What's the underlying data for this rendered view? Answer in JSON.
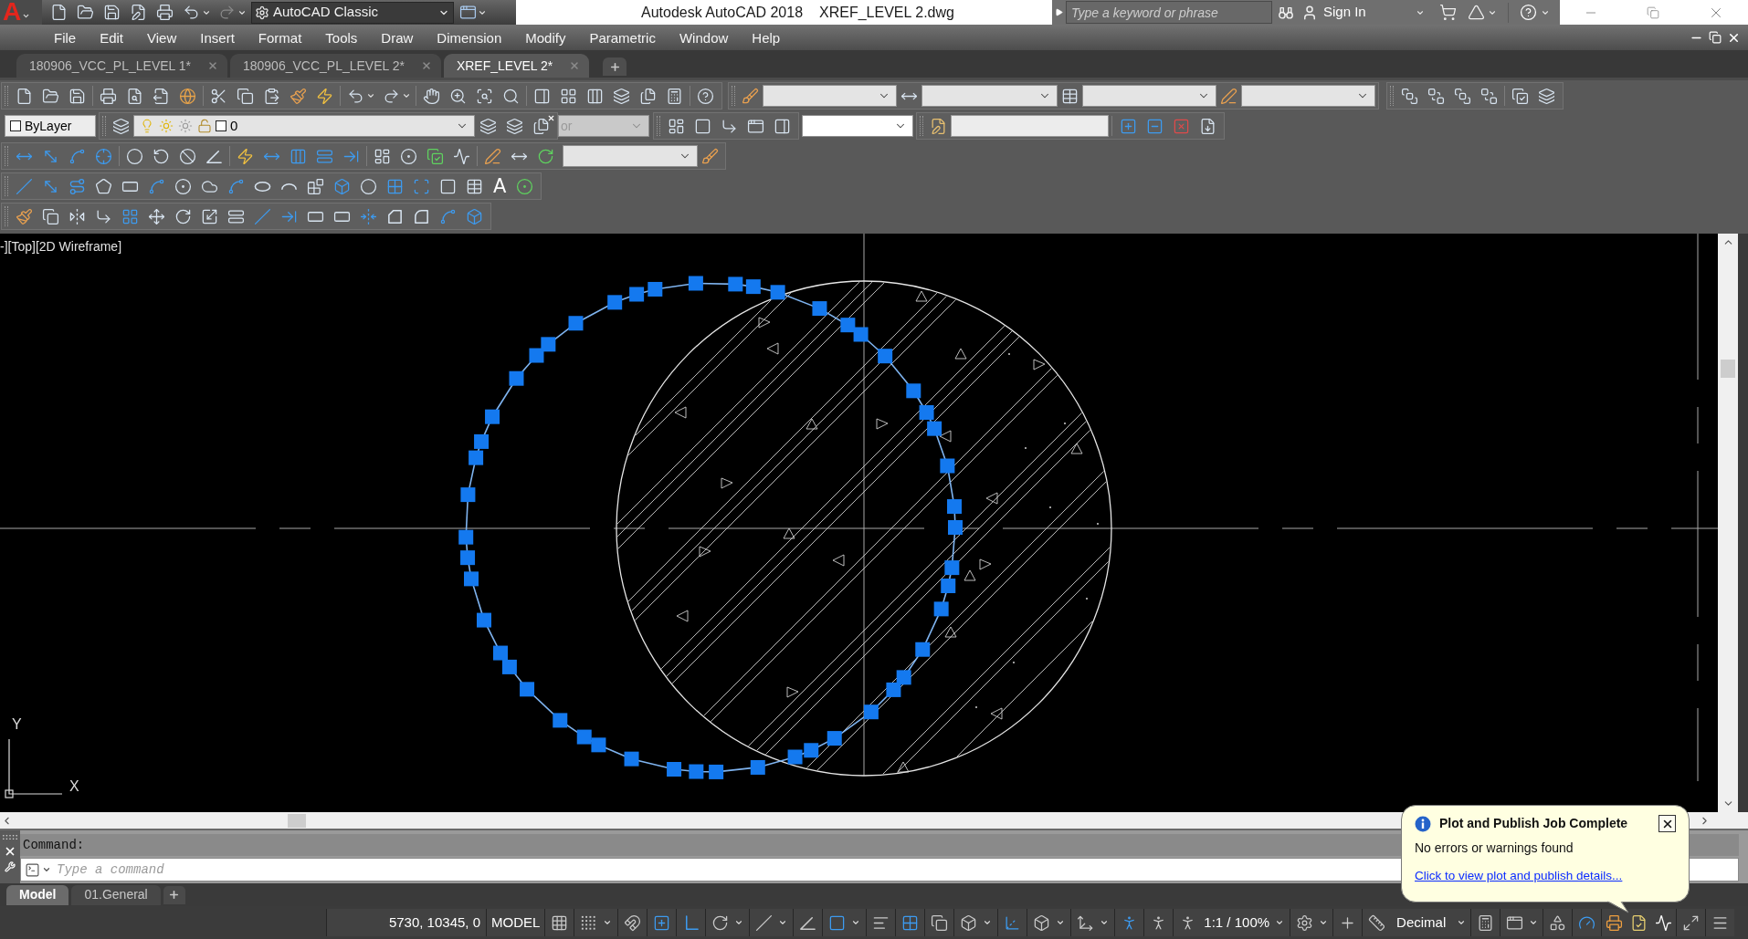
{
  "app_menu": {
    "logo": "A"
  },
  "quick_access": {
    "workspace": "AutoCAD Classic"
  },
  "title_bar": {
    "product": "Autodesk AutoCAD 2018",
    "file": "XREF_LEVEL 2.dwg"
  },
  "search": {
    "placeholder": "Type a keyword or phrase"
  },
  "account": {
    "label": "Sign In"
  },
  "menu_bar": {
    "items": [
      "File",
      "Edit",
      "View",
      "Insert",
      "Format",
      "Tools",
      "Draw",
      "Dimension",
      "Modify",
      "Parametric",
      "Window",
      "Help"
    ]
  },
  "document_tabs": [
    {
      "label": "180906_VCC_PL_LEVEL 1*",
      "selected": false
    },
    {
      "label": "180906_VCC_PL_LEVEL 2*",
      "selected": false
    },
    {
      "label": "XREF_LEVEL 2*",
      "selected": true
    }
  ],
  "toolbars": {
    "color_control": "ByLayer",
    "layer_control": {
      "name": "0",
      "on": true,
      "frozen": false,
      "locked": false
    },
    "plot_style_control": {
      "value": "or",
      "disabled": true
    },
    "multiline_text_tool": "A"
  },
  "viewport": {
    "controls": "-][Top][2D Wireframe]",
    "ucs": {
      "y_label": "Y",
      "x_label": "X"
    }
  },
  "command_line": {
    "history": "Command:",
    "placeholder": "Type a command"
  },
  "layout_tabs": [
    {
      "label": "Model",
      "selected": true
    },
    {
      "label": "01.General",
      "selected": false
    }
  ],
  "status_bar": {
    "coordinates": "5730, 10345, 0",
    "space": "MODEL",
    "drafting_toggles": [
      {
        "kind": "grid",
        "on": false
      },
      {
        "kind": "snap",
        "on": false
      },
      {
        "kind": "infer",
        "on": false
      },
      {
        "kind": "dyninput",
        "on": true
      },
      {
        "kind": "ortho",
        "on": true
      },
      {
        "kind": "polar",
        "on": false
      },
      {
        "kind": "isodraft",
        "on": false
      },
      {
        "kind": "tracking",
        "on": false
      },
      {
        "kind": "osnap",
        "on": true
      },
      {
        "kind": "lineweight",
        "on": false
      },
      {
        "kind": "transparency",
        "on": true
      },
      {
        "kind": "cycling",
        "on": false
      },
      {
        "kind": "osnap3d",
        "on": false
      },
      {
        "kind": "ducs",
        "on": true
      },
      {
        "kind": "filter",
        "on": false
      },
      {
        "kind": "gizmo",
        "on": false
      },
      {
        "kind": "annovis",
        "on": true
      },
      {
        "kind": "autoscale",
        "on": false
      }
    ],
    "annotation_scale": "1:1 / 100%",
    "units": "Decimal",
    "hardware_acceleration": {
      "on": true
    }
  },
  "notification": {
    "title": "Plot and Publish Job Complete",
    "message": "No errors or warnings found",
    "link": "Click to view plot and publish details..."
  }
}
